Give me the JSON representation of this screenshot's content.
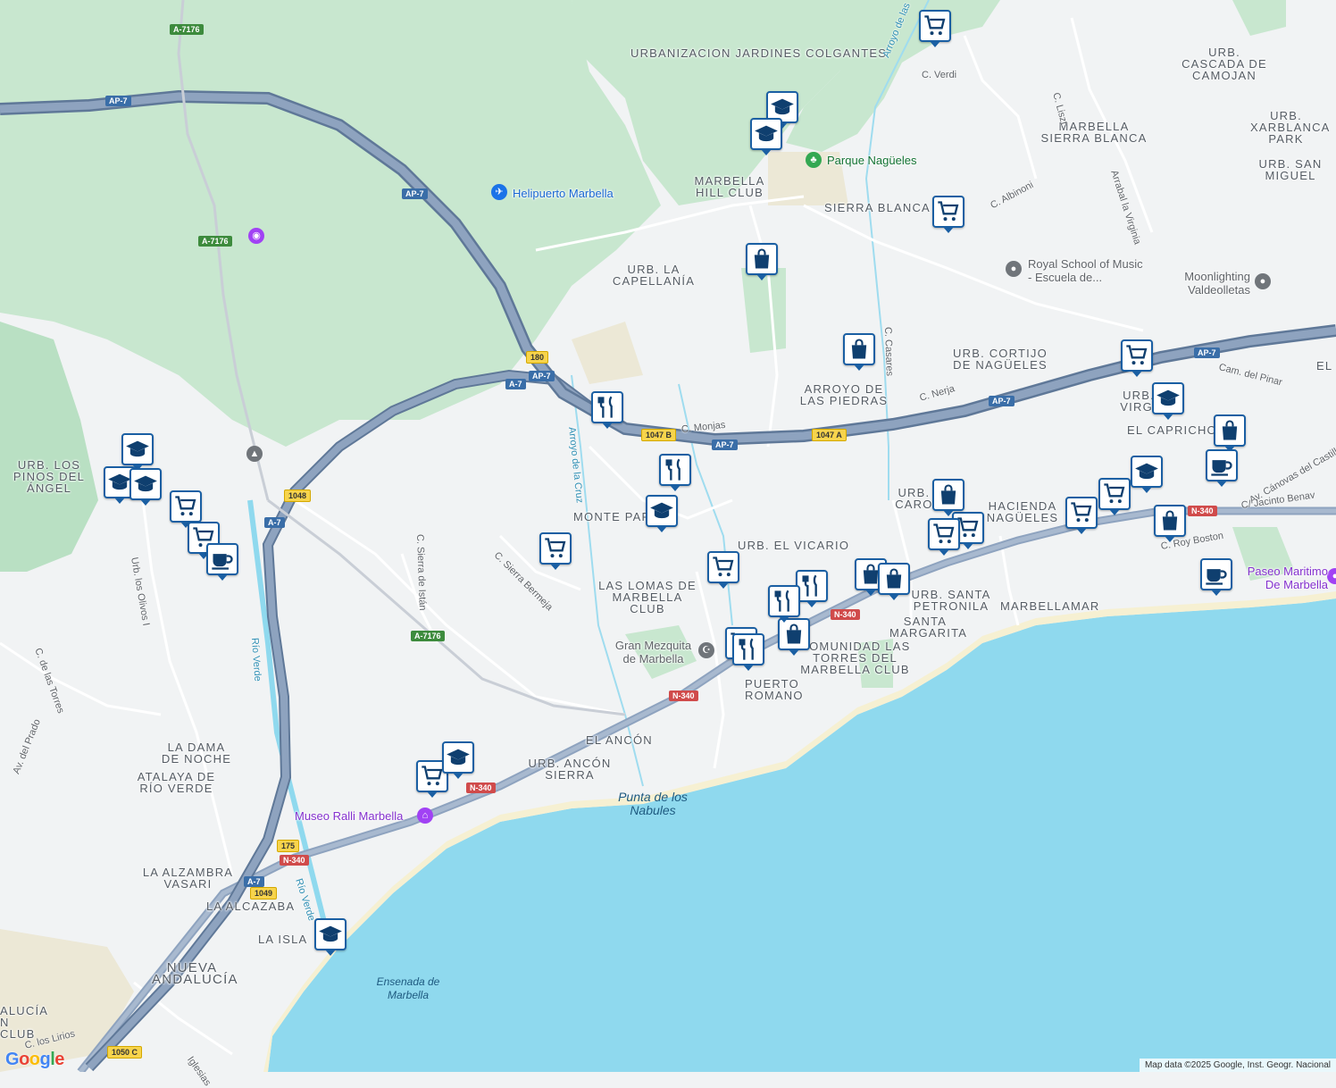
{
  "map": {
    "attribution": "Map data ©2025 Google, Inst. Geogr. Nacional",
    "logo": "Google",
    "colors": {
      "water": "#8fd9ee",
      "land": "#f1f3f4",
      "green": "#c8e7cf",
      "motorway": "#8ea3bf",
      "motorway_edge": "#5f7898",
      "beach": "#f6f0d2"
    }
  },
  "places": [
    "URBANIZACION JARDINES COLGANTES",
    "URB. CASCADA DE CAMOJAN",
    "MARBELLA SIERRA BLANCA",
    "URB. XARBLANCA PARK",
    "URB. SAN MIGUEL",
    "MARBELLA HILL CLUB",
    "SIERRA BLANCA",
    "URB. LA CAPELLANÍA",
    "URB. CORTIJO DE NAGÜELES",
    "ARROYO DE LAS PIEDRAS",
    "URB. VIRGI",
    "EL CAPRICHO",
    "EL",
    "URB. LOS PINOS DEL ÁNGEL",
    "MONTE PAR",
    "URB. EL VICARIO",
    "URB. L CAROLI",
    "HACIENDA NAGÜELES",
    "LAS LOMAS DE MARBELLA CLUB",
    "URB. SANTA PETRONILA",
    "MARBELLAMAR",
    "SANTA MARGARITA",
    "COMUNIDAD LAS TORRES DEL MARBELLA CLUB",
    "PUERTO ROMANO",
    "EL ANCÓN",
    "URB. ANCÓN SIERRA",
    "LA DAMA DE NOCHE",
    "ATALAYA DE RÍO VERDE",
    "LA ALZAMBRA VASARI",
    "LA ALCAZABA",
    "LA ISLA",
    "NUEVA ANDALUCÍA",
    "ALUCÍA N CLUB"
  ],
  "streets": [
    "C. Verdi",
    "C. Liszt",
    "C. Albinoni",
    "Arrabal la Virginia",
    "C. Casares",
    "C. Nerja",
    "Cam. del Pinar",
    "Av. Cánovas del Castillo",
    "C/ Jacinto Benav",
    "C. Monjas",
    "C. Roy Boston",
    "C. Sierra de Istán",
    "C. Sierra Bermeja",
    "Urb. los Olivos I",
    "C. de las Torres",
    "Av. del Prado",
    "C. los Lirios",
    "Iglesias",
    "Arroyo de la Cruz",
    "Arroyo de las",
    "Río Verde",
    "Río Verde"
  ],
  "water_labels": [
    "Punta de los Nabules",
    "Ensenada de Marbella"
  ],
  "pois": [
    "Parque Nagüeles",
    "Helipuerto Marbella",
    "Royal School of Music - Escuela de...",
    "Moonlighting Valdeolletas",
    "Gran Mezquita de Marbella",
    "Paseo Maritimo De Marbella",
    "Museo Ralli Marbella"
  ],
  "shields": [
    "A-7176",
    "AP-7",
    "AP-7",
    "A-7176",
    "180",
    "AP-7",
    "A-7",
    "1047 B",
    "AP-7",
    "1047 A",
    "AP-7",
    "1048",
    "A-7",
    "N-340",
    "N-340",
    "A-7176",
    "N-340",
    "N-340",
    "175",
    "N-340",
    "A-7",
    "1049",
    "1050 C",
    "AP-7"
  ]
}
